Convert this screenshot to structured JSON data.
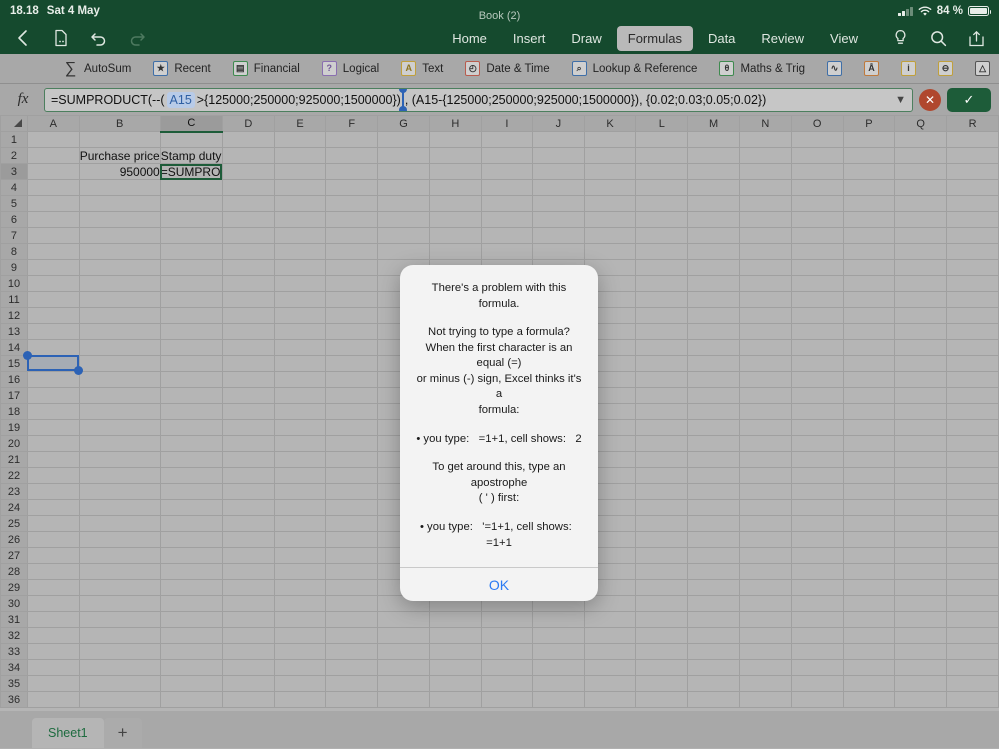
{
  "status_bar": {
    "time": "18.18",
    "date": "Sat 4 May",
    "battery_percent": "84 %",
    "wifi_icon": "wifi-icon",
    "signal_icon": "cellular-signal-icon",
    "battery_icon": "battery-icon"
  },
  "header": {
    "document_title": "Book (2)",
    "back_icon": "back-chevron-icon",
    "file_icon": "file-icon",
    "undo_icon": "undo-icon",
    "redo_icon": "redo-icon",
    "help_icon": "lightbulb-icon",
    "search_icon": "search-icon",
    "share_icon": "share-icon",
    "tabs": [
      {
        "label": "Home",
        "active": false
      },
      {
        "label": "Insert",
        "active": false
      },
      {
        "label": "Draw",
        "active": false
      },
      {
        "label": "Formulas",
        "active": true
      },
      {
        "label": "Data",
        "active": false
      },
      {
        "label": "Review",
        "active": false
      },
      {
        "label": "View",
        "active": false
      }
    ]
  },
  "function_toolbar": {
    "items": [
      {
        "label": "AutoSum",
        "glyph": "∑",
        "icon": "autosum-icon",
        "color": "#333333",
        "boxed": false
      },
      {
        "label": "Recent",
        "glyph": "★",
        "icon": "recent-icon",
        "color": "#3f6fa8",
        "boxed": true
      },
      {
        "label": "Financial",
        "glyph": "▤",
        "icon": "financial-icon",
        "color": "#3f8a4f",
        "boxed": true
      },
      {
        "label": "Logical",
        "glyph": "?",
        "icon": "logical-icon",
        "color": "#8a6fb0",
        "boxed": true
      },
      {
        "label": "Text",
        "glyph": "A",
        "icon": "text-icon",
        "color": "#c0a03c",
        "boxed": true
      },
      {
        "label": "Date & Time",
        "glyph": "◴",
        "icon": "date-time-icon",
        "color": "#b85c4e",
        "boxed": true
      },
      {
        "label": "Lookup & Reference",
        "glyph": "⌕",
        "icon": "lookup-reference-icon",
        "color": "#3f6fa8",
        "boxed": true
      },
      {
        "label": "Maths & Trig",
        "glyph": "θ",
        "icon": "maths-trig-icon",
        "color": "#3f8a4f",
        "boxed": true
      },
      {
        "label": "",
        "glyph": "∿",
        "icon": "statistical-icon",
        "color": "#3f6fa8",
        "boxed": true
      },
      {
        "label": "",
        "glyph": "Å",
        "icon": "engineering-icon",
        "color": "#c07a3c",
        "boxed": true
      },
      {
        "label": "",
        "glyph": "i",
        "icon": "information-icon",
        "color": "#c0a03c",
        "boxed": true
      },
      {
        "label": "",
        "glyph": "⊖",
        "icon": "database-icon",
        "color": "#c0a03c",
        "boxed": true
      },
      {
        "label": "",
        "glyph": "△",
        "icon": "more-functions-icon",
        "color": "#555555",
        "boxed": true
      },
      {
        "label": "",
        "glyph": "▦",
        "icon": "name-manager-icon",
        "color": "#9a6f6f",
        "boxed": true
      }
    ]
  },
  "formula_bar": {
    "fx_label": "fx",
    "formula_prefix": "=SUMPRODUCT(--(",
    "formula_ref": "A15",
    "formula_mid": ">{125000;250000;925000;1500000})",
    "formula_suffix": ", (A15-{125000;250000;925000;1500000}), {0.02;0.03;0.05;0.02})",
    "full_formula": "=SUMPRODUCT(--( A15 >{125000;250000;925000;1500000}), (A15-{125000;250000;925000;1500000}), {0.02;0.03;0.05;0.02})",
    "expand_icon": "chevron-down-icon",
    "cancel_icon": "cancel-icon",
    "confirm_icon": "confirm-check-icon"
  },
  "grid": {
    "columns": [
      "A",
      "B",
      "C",
      "D",
      "E",
      "F",
      "G",
      "H",
      "I",
      "J",
      "K",
      "L",
      "M",
      "N",
      "O",
      "P",
      "Q",
      "R"
    ],
    "selected_column": "C",
    "rows": [
      1,
      2,
      3,
      4,
      5,
      6,
      7,
      8,
      9,
      10,
      11,
      12,
      13,
      14,
      15,
      16,
      17,
      18,
      19,
      20,
      21,
      22,
      23,
      24,
      25,
      26,
      27,
      28,
      29,
      30,
      31,
      32,
      33,
      34,
      35,
      36
    ],
    "selected_row": 3,
    "cells": [
      {
        "row": 2,
        "col": "B",
        "value": "Purchase  price",
        "align": "left"
      },
      {
        "row": 2,
        "col": "C",
        "value": "Stamp duty",
        "align": "left"
      },
      {
        "row": 3,
        "col": "B",
        "value": "950000",
        "align": "right"
      }
    ],
    "editing_cell": {
      "row": 3,
      "col": "C",
      "value": "=SUMPRO"
    },
    "selection_cell": {
      "row": 15,
      "col": "A"
    }
  },
  "dialog": {
    "title": "There's a problem with this formula.",
    "paragraph2_line1": "Not trying to type a formula?",
    "paragraph2_line2": "When the first character is an equal (=)",
    "paragraph2_line3": "or minus (-) sign, Excel thinks it's a",
    "paragraph2_line4": "formula:",
    "bullet1": "• you type:   =1+1, cell shows:   2",
    "paragraph3_line1": "To get around this, type an apostrophe",
    "paragraph3_line2": "( ' ) first:",
    "bullet2": "• you type:   '=1+1, cell shows:   =1+1",
    "ok_label": "OK"
  },
  "sheet_bar": {
    "sheets": [
      {
        "name": "Sheet1",
        "active": true
      }
    ],
    "add_label": "+"
  },
  "colors": {
    "brand_green": "#154a2e",
    "accent_blue": "#2c62b5",
    "dialog_link": "#2b7bf3",
    "confirm_green": "#1d5c39",
    "cancel_red": "#b0472e"
  }
}
